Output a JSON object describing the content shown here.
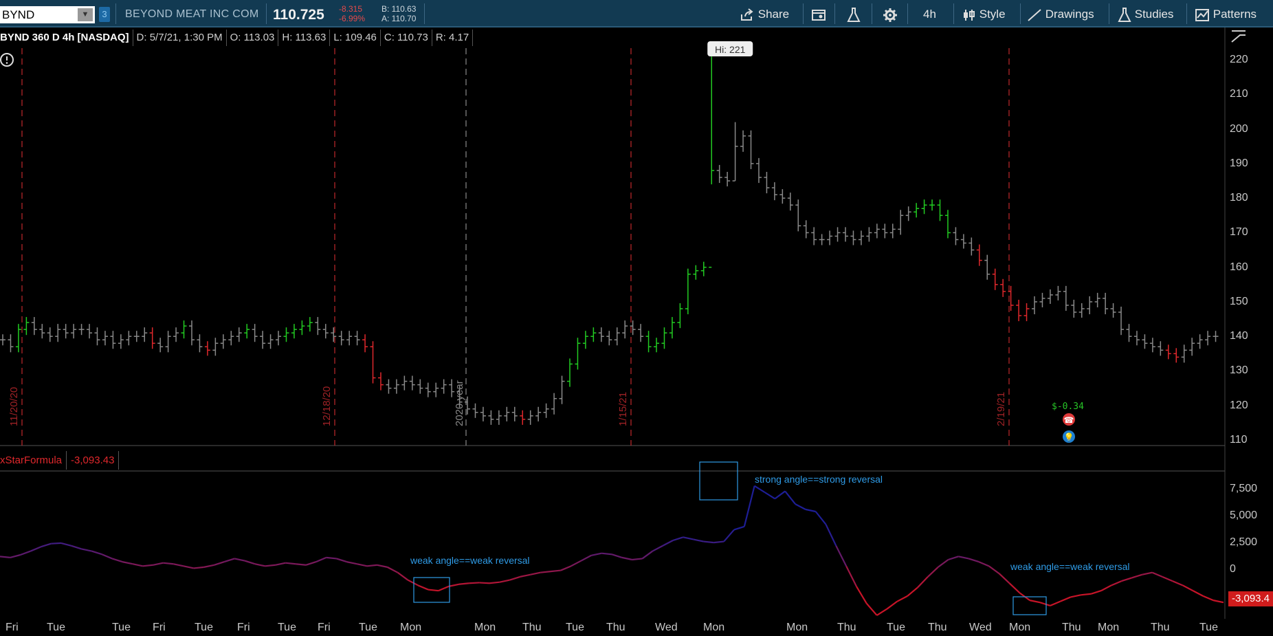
{
  "toolbar": {
    "symbol": "BYND",
    "link_badge": "3",
    "company": "BEYOND MEAT INC COM",
    "last_price": "110.725",
    "change": "-8.315",
    "change_pct": "-6.99%",
    "bid": "B: 110.63",
    "ask": "A: 110.70",
    "share_label": "Share",
    "timeframe_label": "4h",
    "style_label": "Style",
    "drawings_label": "Drawings",
    "studies_label": "Studies",
    "patterns_label": "Patterns"
  },
  "info_bar": {
    "title": "BYND 360 D 4h [NASDAQ]",
    "date": "D: 5/7/21, 1:30 PM",
    "open": "O: 113.03",
    "high": "H: 113.63",
    "low": "L: 109.46",
    "close": "C: 110.73",
    "range": "R: 4.17"
  },
  "price_callout": "Hi: 221",
  "pl_label": "$-0.34",
  "oscillator": {
    "name": "xStarFormula",
    "value": "-3,093.43",
    "readout": "-3,093.4"
  },
  "annotations": {
    "strong": "strong angle==strong reversal",
    "weak_left": "weak angle==weak reversal",
    "weak_right": "weak angle==weak reversal"
  },
  "period_labels": [
    "11/20/20",
    "12/18/20",
    "2020 year",
    "1/15/21",
    "2/19/21"
  ],
  "colors": {
    "up": "#22cc22",
    "down": "#e0282c",
    "neutral": "#8a8a8a",
    "toolbar_bg": "#123a52",
    "annotation": "#2f9be6"
  },
  "chart_data": [
    {
      "type": "ohlc",
      "title": "BYND 360 D 4h [NASDAQ]",
      "ylim": [
        110,
        225
      ],
      "y_ticks": [
        220,
        210,
        200,
        190,
        180,
        170,
        160,
        150,
        140,
        130,
        120,
        110
      ],
      "x_ticks": [
        "Fri",
        "Tue",
        "Tue",
        "Fri",
        "Tue",
        "Fri",
        "Tue",
        "Fri",
        "Tue",
        "Mon",
        "Mon",
        "Thu",
        "Tue",
        "Thu",
        "Wed",
        "Mon",
        "Mon",
        "Thu",
        "Tue",
        "Thu",
        "Wed",
        "Mon",
        "Thu",
        "Mon",
        "Thu",
        "Tue"
      ],
      "bar_colors": [
        "n",
        "n",
        "u",
        "u",
        "n",
        "n",
        "n",
        "n",
        "n",
        "n",
        "n",
        "n",
        "n",
        "n",
        "n",
        "n",
        "n",
        "n",
        "n",
        "d",
        "n",
        "n",
        "n",
        "u",
        "n",
        "n",
        "d",
        "n",
        "n",
        "n",
        "n",
        "u",
        "n",
        "n",
        "n",
        "n",
        "u",
        "u",
        "u",
        "u",
        "n",
        "n",
        "n",
        "n",
        "n",
        "n",
        "d",
        "d",
        "d",
        "n",
        "n",
        "n",
        "n",
        "n",
        "n",
        "n",
        "n",
        "n",
        "n",
        "n",
        "n",
        "n",
        "n",
        "n",
        "n",
        "n",
        "d",
        "n",
        "n",
        "n",
        "n",
        "n",
        "u",
        "u",
        "u",
        "u",
        "n",
        "n",
        "n",
        "n",
        "n",
        "n",
        "u",
        "u",
        "u",
        "u",
        "u",
        "u",
        "u",
        "u",
        "u",
        "n",
        "n",
        "n",
        "n",
        "n",
        "n",
        "n",
        "n",
        "n",
        "n",
        "n",
        "n",
        "n",
        "n",
        "n",
        "n",
        "n",
        "n",
        "n",
        "n",
        "n",
        "n",
        "n",
        "n",
        "n",
        "u",
        "u",
        "u",
        "u",
        "u",
        "n",
        "n",
        "n",
        "d",
        "n",
        "d",
        "d",
        "d",
        "d",
        "d",
        "n",
        "n",
        "n",
        "n",
        "n",
        "n",
        "n",
        "n",
        "n",
        "n",
        "n",
        "n",
        "n",
        "n",
        "n",
        "n",
        "n",
        "d",
        "d",
        "n",
        "n",
        "n",
        "n",
        "n"
      ],
      "closes": [
        139,
        137,
        142,
        144,
        142,
        141,
        140,
        142,
        141,
        142,
        142,
        141,
        139,
        140,
        138,
        139,
        140,
        140,
        141,
        138,
        137,
        140,
        141,
        143,
        139,
        137,
        136,
        138,
        139,
        140,
        141,
        142,
        140,
        138,
        139,
        140,
        141,
        142,
        143,
        144,
        142,
        141,
        140,
        139,
        140,
        139,
        137,
        128,
        126,
        125,
        126,
        127,
        126,
        125,
        124,
        125,
        126,
        124,
        121,
        119,
        118,
        117,
        116,
        117,
        118,
        117,
        116,
        117,
        118,
        119,
        122,
        127,
        132,
        138,
        140,
        141,
        140,
        139,
        141,
        143,
        142,
        140,
        137,
        138,
        141,
        144,
        148,
        158,
        159,
        160,
        188,
        186,
        185,
        195,
        198,
        190,
        186,
        183,
        181,
        180,
        178,
        172,
        170,
        168,
        168,
        169,
        170,
        169,
        168,
        169,
        170,
        171,
        170,
        171,
        175,
        176,
        177,
        178,
        178,
        175,
        170,
        168,
        167,
        165,
        162,
        158,
        155,
        153,
        149,
        146,
        148,
        150,
        151,
        152,
        153,
        149,
        147,
        148,
        150,
        151,
        148,
        147,
        142,
        140,
        139,
        138,
        137,
        136,
        135,
        134,
        136,
        138,
        139,
        140,
        140
      ],
      "series_note_hidden": ""
    },
    {
      "type": "line",
      "title": "xStarFormula",
      "ylim": [
        -4500,
        9000
      ],
      "y_ticks": [
        7500,
        5000,
        2500,
        0
      ],
      "values": [
        1200,
        1100,
        1350,
        1700,
        2100,
        2400,
        2450,
        2200,
        1900,
        1700,
        1400,
        1000,
        700,
        500,
        300,
        400,
        600,
        500,
        300,
        100,
        200,
        400,
        700,
        1000,
        800,
        500,
        300,
        400,
        600,
        500,
        400,
        700,
        1100,
        1000,
        700,
        500,
        300,
        400,
        200,
        -300,
        -1000,
        -1500,
        -1900,
        -2000,
        -1600,
        -1400,
        -1300,
        -1250,
        -1300,
        -1200,
        -1000,
        -700,
        -500,
        -300,
        -200,
        -100,
        300,
        800,
        1300,
        1500,
        1400,
        1100,
        900,
        1000,
        1700,
        2200,
        2700,
        3000,
        2800,
        2600,
        2500,
        2600,
        3700,
        4000,
        7800,
        7200,
        6600,
        7300,
        6100,
        5600,
        5400,
        4200,
        2200,
        300,
        -1600,
        -3200,
        -4300,
        -3700,
        -3000,
        -2500,
        -1700,
        -700,
        200,
        900,
        1200,
        1000,
        700,
        300,
        -400,
        -1300,
        -2200,
        -2900,
        -3100,
        -3400,
        -3000,
        -2600,
        -2400,
        -2300,
        -2000,
        -1500,
        -1100,
        -800,
        -500,
        -300,
        -700,
        -1100,
        -1500,
        -2000,
        -2500,
        -2900,
        -3100
      ]
    }
  ]
}
